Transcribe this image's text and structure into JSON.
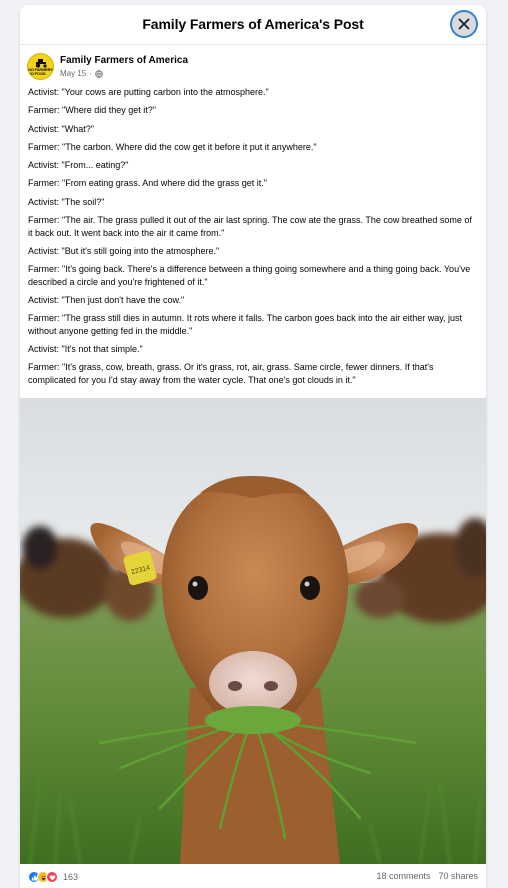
{
  "modal": {
    "title": "Family Farmers of America's Post"
  },
  "post": {
    "author": "Family Farmers of America",
    "date": "May 15",
    "avatar_text": "NO FARMERS NO FOOD",
    "lines": [
      "Activist: \"Your cows are putting carbon into the atmosphere.\"",
      "Farmer: \"Where did they get it?\"",
      "Activist: \"What?\"",
      "Farmer: \"The carbon. Where did the cow get it before it put it anywhere.\"",
      "Activist: \"From... eating?\"",
      "Farmer: \"From eating grass. And where did the grass get it.\"",
      "Activist: \"The soil?\"",
      "Farmer: \"The air. The grass pulled it out of the air last spring. The cow ate the grass. The cow breathed some of it back out. It went back into the air it came from.\"",
      "Activist: \"But it's still going into the atmosphere.\"",
      "Farmer: \"It's going back. There's a difference between a thing going somewhere and a thing going back. You've described a circle and you're frightened of it.\"",
      "Activist: \"Then just don't have the cow.\"",
      "Farmer: \"The grass still dies in autumn. It rots where it falls. The carbon goes back into the air either way, just without anyone getting fed in the middle.\"",
      "Activist: \"It's not that simple.\"",
      "Farmer: \"It's grass, cow, breath, grass. Or it's grass, rot, air, grass. Same circle, fewer dinners. If that's complicated for you I'd stay away from the water cycle. That one's got clouds in it.\""
    ],
    "photo_tag_text": "22314"
  },
  "footer": {
    "reaction_count": "163",
    "comments": "18 comments",
    "shares": "70 shares",
    "reaction_icons": [
      "like-icon",
      "haha-icon",
      "love-icon"
    ]
  },
  "colors": {
    "accent": "#1877f2",
    "close_ring": "#3b82c4",
    "avatar_bg": "#f3d21a"
  }
}
